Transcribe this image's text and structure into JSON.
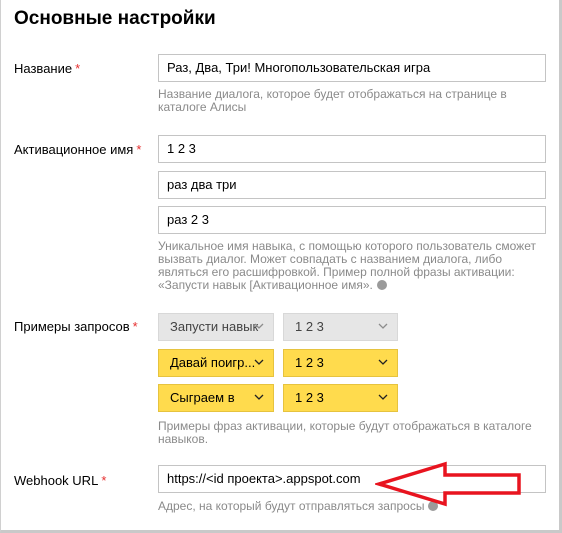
{
  "section_title": "Основные настройки",
  "fields": {
    "name": {
      "label": "Название",
      "required_mark": "*",
      "value": "Раз, Два, Три! Многопользовательская игра",
      "hint": "Название диалога, которое будет отображаться на странице в каталоге Алисы"
    },
    "activation": {
      "label": "Активационное имя",
      "required_mark": "*",
      "values": [
        "1 2 3",
        "раз два три",
        "раз 2 3"
      ],
      "hint": "Уникальное имя навыка, с помощью которого пользователь сможет вызвать диалог. Может совпадать с названием диалога, либо являться его расшифровкой. Пример полной фразы активации: «Запусти навык [Активационное имя»."
    },
    "examples": {
      "label": "Примеры запросов",
      "required_mark": "*",
      "rows": [
        {
          "phrase": "Запусти навык",
          "name": "1 2 3",
          "disabled": true
        },
        {
          "phrase": "Давай поигр...",
          "name": "1 2 3",
          "disabled": false
        },
        {
          "phrase": "Сыграем в",
          "name": "1 2 3",
          "disabled": false
        }
      ],
      "hint": "Примеры фраз активации, которые будут отображаться в каталоге навыков."
    },
    "webhook": {
      "label": "Webhook URL",
      "required_mark": "*",
      "value": "https://<id проекта>.appspot.com",
      "hint": "Адрес, на который будут отправляться запросы"
    }
  },
  "colors": {
    "required": "#e62e2e",
    "select_active": "#ffdb4d",
    "select_disabled": "#e6e6e6",
    "hint_text": "#8a8a8a",
    "annotation_arrow": "#e8141f"
  },
  "icons": {
    "info": "info-circle-icon",
    "dropdown": "chevron-down-icon",
    "annotation": "left-arrow-annotation"
  }
}
